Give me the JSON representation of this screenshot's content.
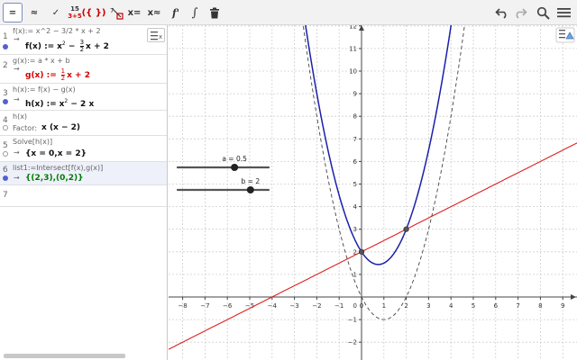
{
  "toolbar": {
    "buttons": [
      {
        "name": "algebra-equals-button",
        "label": "=",
        "icon": "equals"
      },
      {
        "name": "approx-button",
        "label": "≈",
        "icon": "approx"
      },
      {
        "name": "check-button",
        "label": "✓",
        "icon": "checkmark"
      },
      {
        "name": "numeric-button",
        "label_top": "15",
        "label_bottom": "3+5",
        "icon": "numeric-fraction"
      },
      {
        "name": "substitute-button",
        "label": "({ })",
        "icon": "braces"
      },
      {
        "name": "keep-input-button",
        "label": "7",
        "icon": "keep-input"
      },
      {
        "name": "solve-button",
        "label": "x=",
        "icon": "solve"
      },
      {
        "name": "nsolve-button",
        "label": "x≈",
        "icon": "nsolve"
      },
      {
        "name": "derivative-button",
        "label": "f'",
        "icon": "derivative"
      },
      {
        "name": "integral-button",
        "label": "∫",
        "icon": "integral"
      },
      {
        "name": "delete-button",
        "label": "",
        "icon": "trash"
      }
    ],
    "right": [
      "undo-icon",
      "redo-icon",
      "search-icon",
      "menu-icon"
    ]
  },
  "algebra": {
    "rows": [
      {
        "n": "1",
        "input": "f(x):= x^2 − 3/2 * x + 2",
        "out_name": "f(x) :=",
        "out_pre": "x",
        "out_sup": "2",
        "out_mid": " − ",
        "frac_num": "3",
        "frac_den": "2",
        "out_post": "x + 2",
        "color": "black",
        "dot": "on"
      },
      {
        "n": "2",
        "input": "g(x):= a * x + b",
        "out_name": "g(x) :=",
        "frac_num": "1",
        "frac_den": "2",
        "out_post": "x + 2",
        "color": "red",
        "dot": "none"
      },
      {
        "n": "3",
        "input": "h(x):= f(x) − g(x)",
        "out_name": "h(x) :=",
        "out_pre": "x",
        "out_sup": "2",
        "out_post": " − 2 x",
        "color": "black",
        "dot": "on"
      },
      {
        "n": "4",
        "input": "h(x)",
        "label": "Factor:",
        "out": "x (x − 2)",
        "color": "black",
        "dot": "off"
      },
      {
        "n": "5",
        "input": "Solve[h(x)]",
        "out": "{x = 0,x = 2}",
        "color": "black",
        "dot": "off"
      },
      {
        "n": "6",
        "input": "list1:=Intersect[f(x),g(x)]",
        "out": "{(2,3),(0,2)}",
        "color": "green",
        "dot": "on"
      },
      {
        "n": "7"
      }
    ]
  },
  "graphics": {
    "sliders": [
      {
        "label": "a = 0.5",
        "value": 0.5,
        "min": -2,
        "max": 2
      },
      {
        "label": "b = 2",
        "value": 2,
        "min": -2,
        "max": 3
      }
    ],
    "colors": {
      "f": "#1b1fa8",
      "g": "#dd2222",
      "h": "#444444",
      "point": "#555555",
      "grid": "#cfcfcf"
    }
  },
  "chart_data": {
    "type": "line",
    "title": "",
    "xlabel": "",
    "ylabel": "",
    "xlim": [
      -8.5,
      9
    ],
    "ylim": [
      -2.5,
      12
    ],
    "x_ticks": [
      -8,
      -7,
      -6,
      -5,
      -4,
      -3,
      -2,
      -1,
      0,
      1,
      2,
      3,
      4,
      5,
      6,
      7,
      8,
      9
    ],
    "y_ticks": [
      -2,
      -1,
      1,
      2,
      3,
      4,
      5,
      6,
      7,
      8,
      9,
      10,
      11,
      12
    ],
    "origin_label": "0",
    "grid": true,
    "series": [
      {
        "name": "f",
        "expr": "x^2 - 1.5x + 2",
        "style": "solid"
      },
      {
        "name": "g",
        "expr": "0.5x + 2",
        "style": "solid"
      },
      {
        "name": "h",
        "expr": "x^2 - 2x",
        "style": "dashed"
      }
    ],
    "points": [
      {
        "x": 2,
        "y": 3
      },
      {
        "x": 0,
        "y": 2
      }
    ]
  }
}
